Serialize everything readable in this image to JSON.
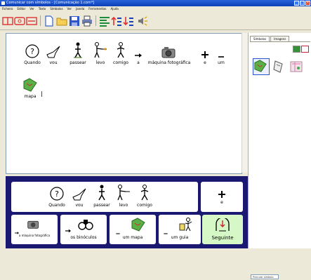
{
  "window": {
    "title": "Comunicar com símbolos - [Comunicação 1.com*]"
  },
  "menu": [
    "Ficheiro",
    "Editar",
    "Ver",
    "Texto",
    "Símbolos",
    "Ver",
    "Janela",
    "Ferramentas",
    "Ajuda"
  ],
  "document": {
    "symbols": [
      {
        "label": "Quando",
        "icon": "clock-question-icon"
      },
      {
        "label": "vou",
        "icon": "pointing-hand-icon"
      },
      {
        "label": "passear",
        "icon": "walking-person-icon"
      },
      {
        "label": "levo",
        "icon": "person-carry-icon"
      },
      {
        "label": "comigo",
        "icon": "self-person-icon"
      },
      {
        "label": "a",
        "icon": "arrow-right-icon"
      },
      {
        "label": "máquina fotográfica",
        "icon": "camera-icon"
      },
      {
        "label": "e",
        "icon": "plus-icon"
      },
      {
        "label": "um",
        "icon": "one-dash-icon"
      }
    ],
    "second_line": [
      {
        "label": "mapa",
        "icon": "map-icon"
      }
    ]
  },
  "right_panel": {
    "tabs": [
      "Símbolos",
      "Imagens"
    ],
    "search_placeholder": "Procurar símbolo"
  },
  "prediction": {
    "phrase": [
      {
        "label": "Quando",
        "icon": "clock-question-icon"
      },
      {
        "label": "vou",
        "icon": "pointing-hand-icon"
      },
      {
        "label": "passear",
        "icon": "walking-person-icon"
      },
      {
        "label": "levo",
        "icon": "person-carry-icon"
      },
      {
        "label": "comigo",
        "icon": "self-person-icon"
      }
    ],
    "plus": {
      "label": "e"
    },
    "items": [
      {
        "label": "a máquina fotográfica"
      },
      {
        "label": "os binóculos"
      },
      {
        "label": "um mapa"
      },
      {
        "label": "um guia"
      }
    ],
    "next": {
      "label": "Seguinte"
    }
  }
}
